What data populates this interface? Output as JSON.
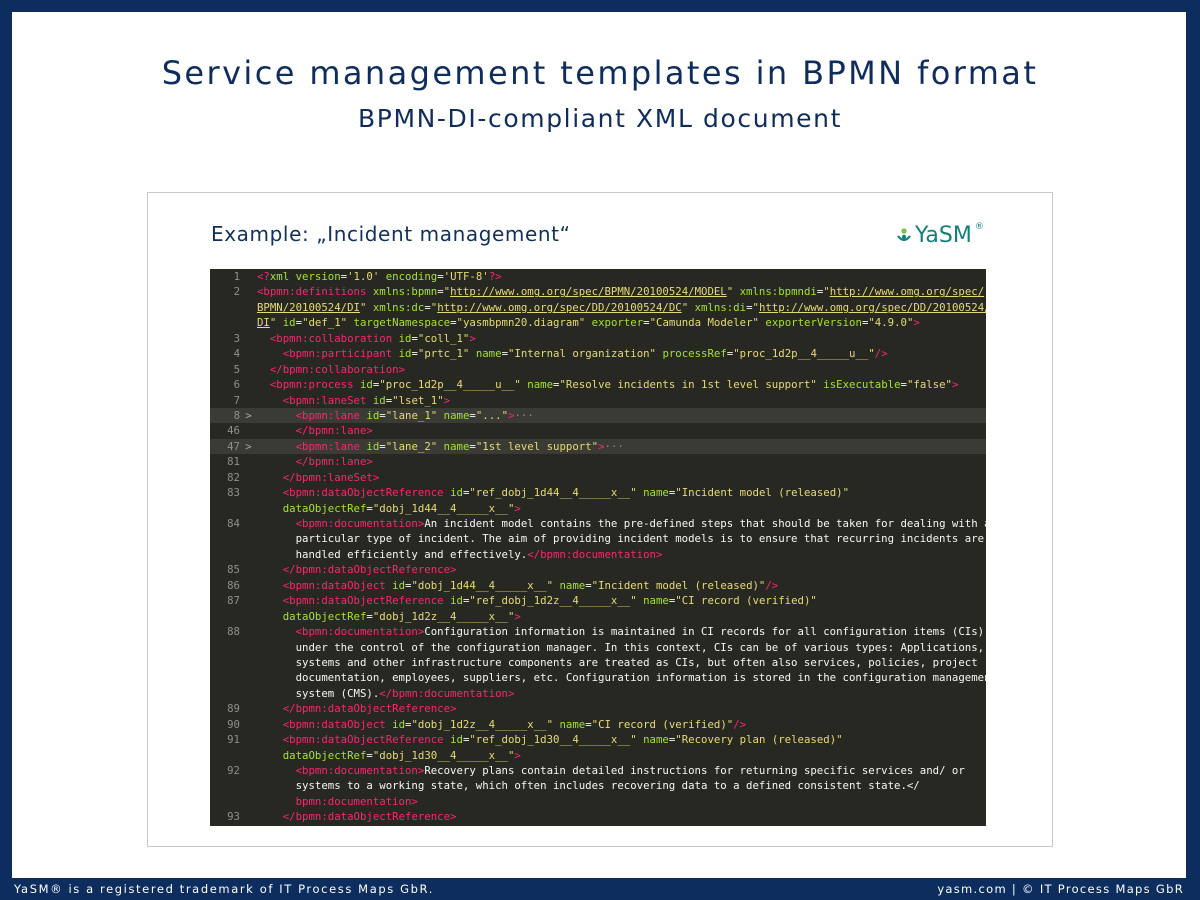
{
  "header": {
    "title": "Service management templates in BPMN format",
    "subtitle": "BPMN-DI-compliant XML document"
  },
  "card": {
    "heading": "Example: „Incident management“",
    "logo_text": "YaSM",
    "logo_mark": "®"
  },
  "code": {
    "lines": [
      {
        "n": "1",
        "fold": "",
        "html": "<span class=\"t\">&lt;?</span><span class=\"a\">xml</span> <span class=\"a\">version</span>=<span class=\"v\">'1.0'</span> <span class=\"a\">encoding</span>=<span class=\"v\">'UTF-8'</span><span class=\"t\">?&gt;</span>"
      },
      {
        "n": "2",
        "fold": "",
        "html": "<span class=\"t\">&lt;bpmn:definitions</span> <span class=\"a\">xmlns:bpmn</span>=<span class=\"v\">\"<span class=\"u\">http://www.omg.org/spec/BPMN/20100524/MODEL</span>\"</span> <span class=\"a\">xmlns:bpmndi</span>=<span class=\"v\">\"<span class=\"u\">http://www.omg.org/spec/</span></span>"
      },
      {
        "n": "",
        "fold": "",
        "html": "<span class=\"v\"><span class=\"u\">BPMN/20100524/DI</span>\"</span> <span class=\"a\">xmlns:dc</span>=<span class=\"v\">\"<span class=\"u\">http://www.omg.org/spec/DD/20100524/DC</span>\"</span> <span class=\"a\">xmlns:di</span>=<span class=\"v\">\"<span class=\"u\">http://www.omg.org/spec/DD/20100524/</span></span>"
      },
      {
        "n": "",
        "fold": "",
        "html": "<span class=\"v\"><span class=\"u\">DI</span>\"</span> <span class=\"a\">id</span>=<span class=\"v\">\"def_1\"</span> <span class=\"a\">targetNamespace</span>=<span class=\"v\">\"yasmbpmn20.diagram\"</span> <span class=\"a\">exporter</span>=<span class=\"v\">\"Camunda Modeler\"</span> <span class=\"a\">exporterVersion</span>=<span class=\"v\">\"4.9.0\"</span><span class=\"t\">&gt;</span>"
      },
      {
        "n": "3",
        "fold": "",
        "html": "  <span class=\"t\">&lt;bpmn:collaboration</span> <span class=\"a\">id</span>=<span class=\"v\">\"coll_1\"</span><span class=\"t\">&gt;</span>"
      },
      {
        "n": "4",
        "fold": "",
        "html": "    <span class=\"t\">&lt;bpmn:participant</span> <span class=\"a\">id</span>=<span class=\"v\">\"prtc_1\"</span> <span class=\"a\">name</span>=<span class=\"v\">\"Internal organization\"</span> <span class=\"a\">processRef</span>=<span class=\"v\">\"proc_1d2p__4_____u__\"</span><span class=\"t\">/&gt;</span>"
      },
      {
        "n": "5",
        "fold": "",
        "html": "  <span class=\"t\">&lt;/bpmn:collaboration&gt;</span>"
      },
      {
        "n": "6",
        "fold": "",
        "html": "  <span class=\"t\">&lt;bpmn:process</span> <span class=\"a\">id</span>=<span class=\"v\">\"proc_1d2p__4_____u__\"</span> <span class=\"a\">name</span>=<span class=\"v\">\"Resolve incidents in 1st level support\"</span> <span class=\"a\">isExecutable</span>=<span class=\"v\">\"false\"</span><span class=\"t\">&gt;</span>"
      },
      {
        "n": "7",
        "fold": "",
        "html": "    <span class=\"t\">&lt;bpmn:laneSet</span> <span class=\"a\">id</span>=<span class=\"v\">\"lset_1\"</span><span class=\"t\">&gt;</span>"
      },
      {
        "n": "8",
        "fold": ">",
        "hl": true,
        "html": "      <span class=\"t\">&lt;bpmn:lane</span> <span class=\"a\">id</span>=<span class=\"v\">\"lane_1\"</span> <span class=\"a\">name</span>=<span class=\"v\">\"...\"</span><span class=\"t\">&gt;</span><span class=\"dots\">···</span>"
      },
      {
        "n": "46",
        "fold": "",
        "html": "      <span class=\"t\">&lt;/bpmn:lane&gt;</span>"
      },
      {
        "n": "47",
        "fold": ">",
        "hl": true,
        "html": "      <span class=\"t\">&lt;bpmn:lane</span> <span class=\"a\">id</span>=<span class=\"v\">\"lane_2\"</span> <span class=\"a\">name</span>=<span class=\"v\">\"1st level support\"</span><span class=\"t\">&gt;</span><span class=\"dots\">···</span>"
      },
      {
        "n": "81",
        "fold": "",
        "html": "      <span class=\"t\">&lt;/bpmn:lane&gt;</span>"
      },
      {
        "n": "82",
        "fold": "",
        "html": "    <span class=\"t\">&lt;/bpmn:laneSet&gt;</span>"
      },
      {
        "n": "83",
        "fold": "",
        "html": "    <span class=\"t\">&lt;bpmn:dataObjectReference</span> <span class=\"a\">id</span>=<span class=\"v\">\"ref_dobj_1d44__4_____x__\"</span> <span class=\"a\">name</span>=<span class=\"v\">\"Incident model (released)\"</span>"
      },
      {
        "n": "",
        "fold": "",
        "html": "    <span class=\"a\">dataObjectRef</span>=<span class=\"v\">\"dobj_1d44__4_____x__\"</span><span class=\"t\">&gt;</span>"
      },
      {
        "n": "84",
        "fold": "",
        "html": "      <span class=\"t\">&lt;bpmn:documentation&gt;</span>An incident model contains the pre-defined steps that should be taken for dealing with a"
      },
      {
        "n": "",
        "fold": "",
        "html": "      particular type of incident. The aim of providing incident models is to ensure that recurring incidents are"
      },
      {
        "n": "",
        "fold": "",
        "html": "      handled efficiently and effectively.<span class=\"t\">&lt;/bpmn:documentation&gt;</span>"
      },
      {
        "n": "85",
        "fold": "",
        "html": "    <span class=\"t\">&lt;/bpmn:dataObjectReference&gt;</span>"
      },
      {
        "n": "86",
        "fold": "",
        "html": "    <span class=\"t\">&lt;bpmn:dataObject</span> <span class=\"a\">id</span>=<span class=\"v\">\"dobj_1d44__4_____x__\"</span> <span class=\"a\">name</span>=<span class=\"v\">\"Incident model (released)\"</span><span class=\"t\">/&gt;</span>"
      },
      {
        "n": "87",
        "fold": "",
        "html": "    <span class=\"t\">&lt;bpmn:dataObjectReference</span> <span class=\"a\">id</span>=<span class=\"v\">\"ref_dobj_1d2z__4_____x__\"</span> <span class=\"a\">name</span>=<span class=\"v\">\"CI record (verified)\"</span>"
      },
      {
        "n": "",
        "fold": "",
        "html": "    <span class=\"a\">dataObjectRef</span>=<span class=\"v\">\"dobj_1d2z__4_____x__\"</span><span class=\"t\">&gt;</span>"
      },
      {
        "n": "88",
        "fold": "",
        "html": "      <span class=\"t\">&lt;bpmn:documentation&gt;</span>Configuration information is maintained in CI records for all configuration items (CIs)"
      },
      {
        "n": "",
        "fold": "",
        "html": "      under the control of the configuration manager. In this context, CIs can be of various types: Applications,"
      },
      {
        "n": "",
        "fold": "",
        "html": "      systems and other infrastructure components are treated as CIs, but often also services, policies, project"
      },
      {
        "n": "",
        "fold": "",
        "html": "      documentation, employees, suppliers, etc. Configuration information is stored in the configuration management"
      },
      {
        "n": "",
        "fold": "",
        "html": "      system (CMS).<span class=\"t\">&lt;/bpmn:documentation&gt;</span>"
      },
      {
        "n": "89",
        "fold": "",
        "html": "    <span class=\"t\">&lt;/bpmn:dataObjectReference&gt;</span>"
      },
      {
        "n": "90",
        "fold": "",
        "html": "    <span class=\"t\">&lt;bpmn:dataObject</span> <span class=\"a\">id</span>=<span class=\"v\">\"dobj_1d2z__4_____x__\"</span> <span class=\"a\">name</span>=<span class=\"v\">\"CI record (verified)\"</span><span class=\"t\">/&gt;</span>"
      },
      {
        "n": "91",
        "fold": "",
        "html": "    <span class=\"t\">&lt;bpmn:dataObjectReference</span> <span class=\"a\">id</span>=<span class=\"v\">\"ref_dobj_1d30__4_____x__\"</span> <span class=\"a\">name</span>=<span class=\"v\">\"Recovery plan (released)\"</span>"
      },
      {
        "n": "",
        "fold": "",
        "html": "    <span class=\"a\">dataObjectRef</span>=<span class=\"v\">\"dobj_1d30__4_____x__\"</span><span class=\"t\">&gt;</span>"
      },
      {
        "n": "92",
        "fold": "",
        "html": "      <span class=\"t\">&lt;bpmn:documentation&gt;</span>Recovery plans contain detailed instructions for returning specific services and/ or"
      },
      {
        "n": "",
        "fold": "",
        "html": "      systems to a working state, which often includes recovering data to a defined consistent state.&lt;/"
      },
      {
        "n": "",
        "fold": "",
        "html": "      <span class=\"t\">bpmn:documentation&gt;</span>"
      },
      {
        "n": "93",
        "fold": "",
        "html": "    <span class=\"t\">&lt;/bpmn:dataObjectReference&gt;</span>"
      }
    ]
  },
  "footer": {
    "left": "YaSM® is a registered trademark of IT Process Maps GbR.",
    "right": "yasm.com | © IT Process Maps GbR"
  }
}
